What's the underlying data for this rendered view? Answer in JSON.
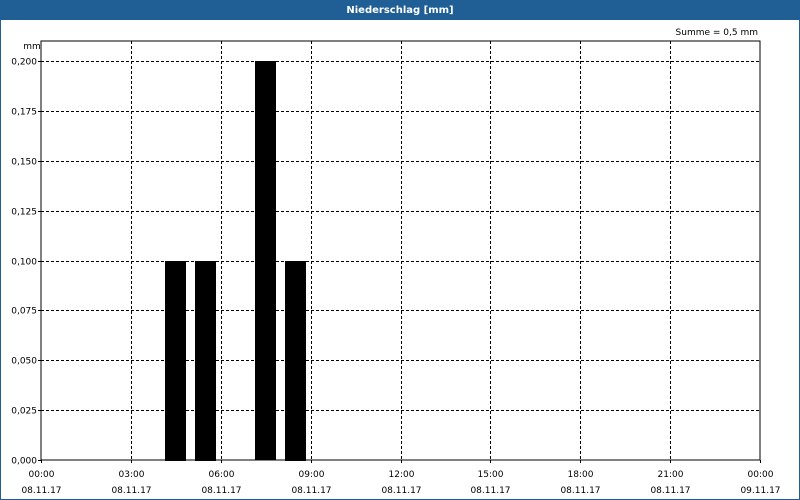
{
  "window": {
    "title": "Niederschlag [mm]"
  },
  "chart_data": {
    "type": "bar",
    "title": "Niederschlag [mm]",
    "ylabel": "mm",
    "annotation": "Summe = 0,5 mm",
    "ylim": [
      0,
      0.2
    ],
    "yticks": [
      "0,000",
      "0,025",
      "0,050",
      "0,075",
      "0,100",
      "0,125",
      "0,150",
      "0,175",
      "0,200"
    ],
    "xrange_hours": [
      0,
      24
    ],
    "xticks": [
      {
        "hour": 0,
        "time": "00:00",
        "date": "08.11.17"
      },
      {
        "hour": 3,
        "time": "03:00",
        "date": "08.11.17"
      },
      {
        "hour": 6,
        "time": "06:00",
        "date": "08.11.17"
      },
      {
        "hour": 9,
        "time": "09:00",
        "date": "08.11.17"
      },
      {
        "hour": 12,
        "time": "12:00",
        "date": "08.11.17"
      },
      {
        "hour": 15,
        "time": "15:00",
        "date": "08.11.17"
      },
      {
        "hour": 18,
        "time": "18:00",
        "date": "08.11.17"
      },
      {
        "hour": 21,
        "time": "21:00",
        "date": "08.11.17"
      },
      {
        "hour": 24,
        "time": "00:00",
        "date": "09.11.17"
      }
    ],
    "bars": [
      {
        "hour": 4.5,
        "value": 0.1
      },
      {
        "hour": 5.5,
        "value": 0.1
      },
      {
        "hour": 7.5,
        "value": 0.2
      },
      {
        "hour": 8.5,
        "value": 0.1
      }
    ],
    "grid": true,
    "bar_color": "#000000",
    "grid_color": "#000000",
    "header_color": "#1f5f96"
  }
}
